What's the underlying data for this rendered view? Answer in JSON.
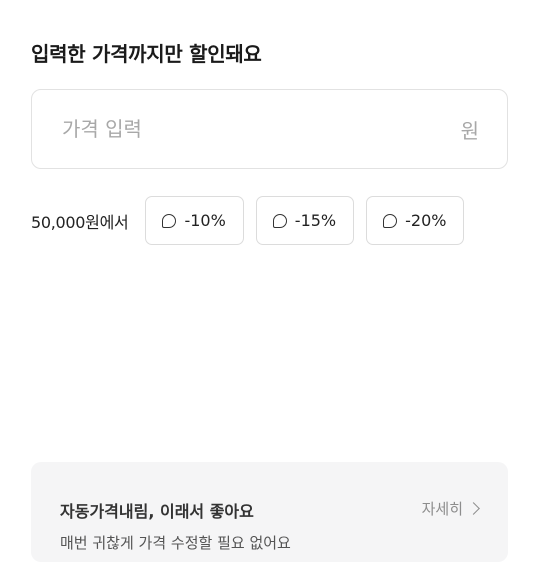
{
  "title": "입력한 가격까지만 할인돼요",
  "price_input": {
    "placeholder": "가격 입력",
    "value": "",
    "unit": "원"
  },
  "discount": {
    "base_text": "50,000원에서",
    "options": [
      {
        "label": "-10%"
      },
      {
        "label": "-15%"
      },
      {
        "label": "-20%"
      }
    ]
  },
  "info_card": {
    "title": "자동가격내림, 이래서 좋아요",
    "more_link": "자세히",
    "body": "매번 귀찮게 가격 수정할 필요 없어요"
  }
}
